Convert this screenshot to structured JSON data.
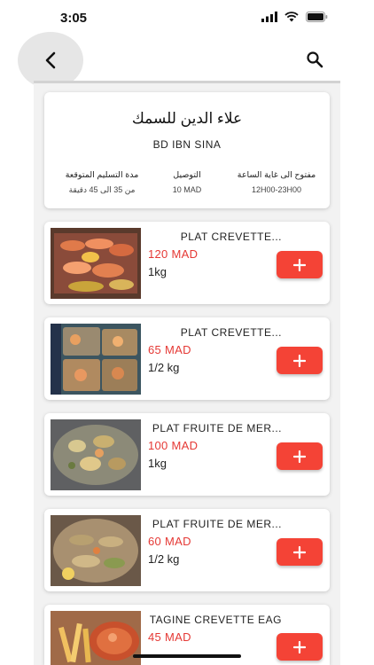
{
  "status_bar": {
    "time": "3:05"
  },
  "header": {
    "back_icon": "chevron-left-icon",
    "search_icon": "search-icon"
  },
  "restaurant": {
    "name": "علاء الدين للسمك",
    "address": "BD IBN SINA",
    "hours_label": "مفتوح الى غاية الساعة",
    "hours_value": "12H00-23H00",
    "delivery_label": "التوصيل",
    "delivery_value": "10 MAD",
    "time_label": "مدة التسليم المتوقعة",
    "time_value": "من 35 الى 45 دقيقة"
  },
  "products": [
    {
      "name": "PLAT CREVETTE...",
      "price": "120 MAD",
      "qty": "1kg"
    },
    {
      "name": "PLAT CREVETTE...",
      "price": "65 MAD",
      "qty": "1/2 kg"
    },
    {
      "name": "PLAT FRUITE DE MER...",
      "price": "100 MAD",
      "qty": "1kg"
    },
    {
      "name": "PLAT FRUITE DE MER...",
      "price": "60 MAD",
      "qty": "1/2 kg"
    },
    {
      "name": "TAGINE CREVETTE EAG",
      "price": "45 MAD",
      "qty": ""
    }
  ],
  "colors": {
    "accent": "#f44336",
    "price": "#e53935",
    "background": "#f2f2f2"
  }
}
